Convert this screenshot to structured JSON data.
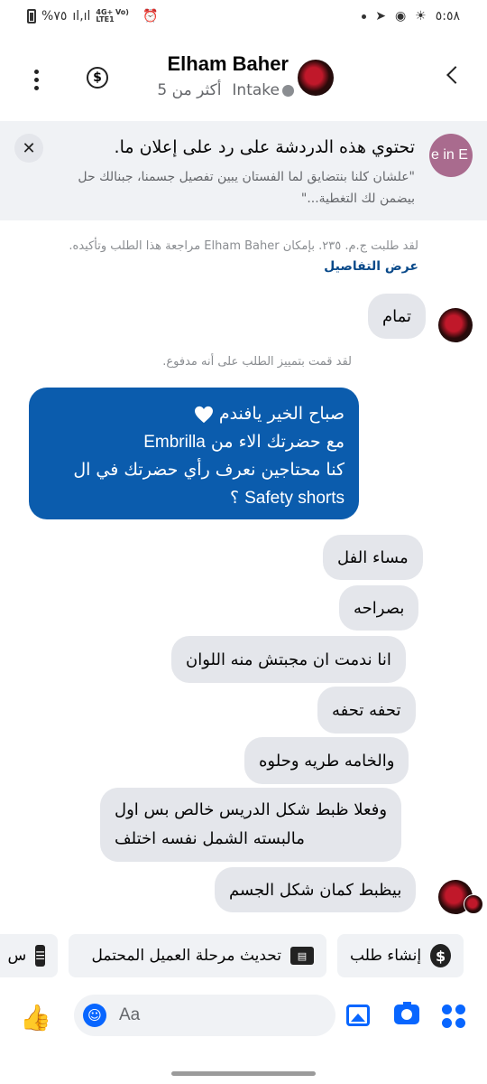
{
  "status_bar": {
    "battery": "%٧٥",
    "network": "4G+ Vo) LTE1",
    "time": "٥:٥٨"
  },
  "header": {
    "name": "Elham Baher",
    "tag": "Intake",
    "time_ago": "أكثر من 5",
    "icons": [
      "more-icon",
      "dollar-icon",
      "back-chevron-icon"
    ]
  },
  "ad_banner": {
    "logo_text": "e in E",
    "title": "تحتوي هذه الدردشة على رد على إعلان ما.",
    "body": "\"علشان كلنا بنتضايق لما الفستان يبين تفصيل جسمنا، جبنالك حل بيضمن لك التغطية...\""
  },
  "system": {
    "order_note": "لقد طلبت ج.م. ٢٣٥. بإمكان Elham Baher مراجعة هذا الطلب وتأكيده.",
    "order_link": "عرض التفاصيل",
    "paid_note": "لقد قمت بتمييز الطلب على أنه مدفوع."
  },
  "messages": {
    "tamam": "تمام",
    "outgoing_line1": "صباح الخير يافندم",
    "outgoing_line2a": "مع حضرتك الاء من",
    "outgoing_line2b": "Embrilla",
    "outgoing_line3": "كنا محتاجين نعرف رأي حضرتك في ال",
    "outgoing_line4a": "Safety shorts",
    "outgoing_line4b": "؟",
    "m1": "مساء الفل",
    "m2": "بصراحه",
    "m3": "انا ندمت ان مجبتش منه اللوان",
    "m4": "تحفه تحفه",
    "m5": "والخامه طريه وحلوه",
    "m6_line1": "وفعلا ظبط شكل الدريس خالص بس اول",
    "m6_line2": "مالبسته الشمل نفسه اختلف",
    "m7": "بيظبط كمان شكل الجسم"
  },
  "quick_actions": {
    "create_order": "إنشاء طلب",
    "update_stage": "تحديث مرحلة العميل المحتمل",
    "partial": "س"
  },
  "composer": {
    "placeholder": "Aa"
  },
  "colors": {
    "outgoing_bubble": "#0b5cad",
    "incoming_bubble": "#e4e6eb",
    "accent": "#0866ff",
    "link": "#0a4a8a"
  }
}
